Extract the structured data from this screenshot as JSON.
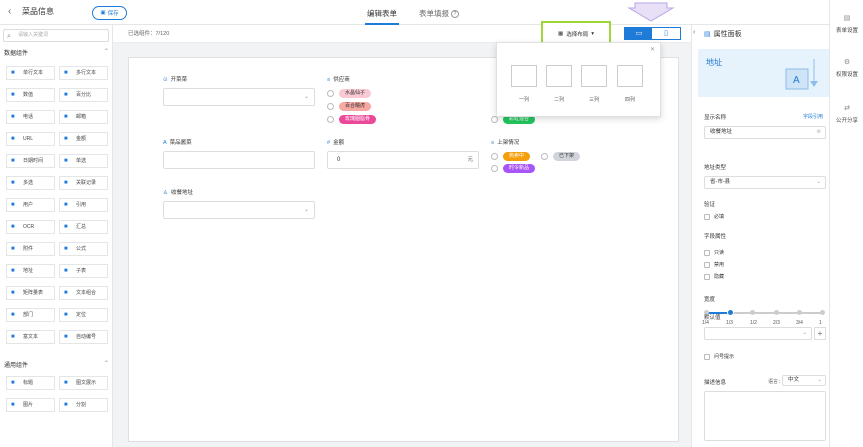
{
  "header": {
    "back_icon": "chevron-left-icon",
    "title": "菜品信息",
    "save_label": "保存",
    "tabs": [
      {
        "label": "编辑表单",
        "active": true
      },
      {
        "label": "表单填报",
        "active": false
      }
    ]
  },
  "left": {
    "search_placeholder": "请输入关键词",
    "groups": [
      {
        "title": "数据组件",
        "items": [
          {
            "label": "单行文本",
            "icon": "text-icon"
          },
          {
            "label": "多行文本",
            "icon": "multiline-icon"
          },
          {
            "label": "数值",
            "icon": "number-icon"
          },
          {
            "label": "百分比",
            "icon": "percent-icon"
          },
          {
            "label": "电话",
            "icon": "phone-icon"
          },
          {
            "label": "邮箱",
            "icon": "mail-icon"
          },
          {
            "label": "URL",
            "icon": "link-icon"
          },
          {
            "label": "金额",
            "icon": "money-icon"
          },
          {
            "label": "日期时间",
            "icon": "calendar-icon"
          },
          {
            "label": "单选",
            "icon": "radio-icon"
          },
          {
            "label": "多选",
            "icon": "checkbox-icon"
          },
          {
            "label": "关联记录",
            "icon": "relation-icon"
          },
          {
            "label": "用户",
            "icon": "user-icon"
          },
          {
            "label": "引用",
            "icon": "quote-icon"
          },
          {
            "label": "OCR",
            "icon": "ocr-icon"
          },
          {
            "label": "汇总",
            "icon": "sum-icon"
          },
          {
            "label": "附件",
            "icon": "attachment-icon"
          },
          {
            "label": "公式",
            "icon": "formula-icon"
          },
          {
            "label": "地址",
            "icon": "location-icon"
          },
          {
            "label": "子表",
            "icon": "subtable-icon"
          },
          {
            "label": "矩阵量表",
            "icon": "matrix-icon"
          },
          {
            "label": "文本组合",
            "icon": "text-combo-icon"
          },
          {
            "label": "部门",
            "icon": "department-icon"
          },
          {
            "label": "定位",
            "icon": "position-icon"
          },
          {
            "label": "富文本",
            "icon": "richtext-icon"
          },
          {
            "label": "自动编号",
            "icon": "autonumber-icon"
          }
        ]
      },
      {
        "title": "通用组件",
        "items": [
          {
            "label": "标题",
            "icon": "heading-icon"
          },
          {
            "label": "图文展示",
            "icon": "image-text-icon"
          },
          {
            "label": "图片",
            "icon": "image-icon"
          },
          {
            "label": "分割",
            "icon": "divider-icon"
          }
        ]
      }
    ]
  },
  "canvas": {
    "selected_count": "已选组件：7/120",
    "fields": [
      {
        "label": "开菜菜",
        "icon": "radio-circle-icon"
      },
      {
        "label": "供应商",
        "icon": "list-icon",
        "options": [
          "水晶仙子",
          "百合糯虎",
          "玫瑰胭脂骨"
        ],
        "colors": [
          "#f9c9d4",
          "#f7a8a3",
          "#ec4899"
        ]
      },
      {
        "label": "彩虹混合",
        "color": "#22c55e"
      },
      {
        "label": "菜品酱菜",
        "icon": "text-icon"
      },
      {
        "label": "金额",
        "icon": "hash-icon",
        "value": "0",
        "unit": "元"
      },
      {
        "label": "上架情况",
        "icon": "list-icon",
        "options": [
          "热卖中",
          "已下架",
          "时令新品"
        ],
        "colors": [
          "#f59e0b",
          "#d1d5db",
          "#a855f7"
        ]
      },
      {
        "label": "收餐地址",
        "icon": "user-icon"
      }
    ]
  },
  "toolbar": {
    "layout_label": "选择布局",
    "layout_icon": "layout-icon",
    "desktop_icon": "desktop-icon",
    "mobile_icon": "mobile-icon",
    "layouts": [
      "一列",
      "二列",
      "三列",
      "四列"
    ]
  },
  "props": {
    "title": "属性面板",
    "banner_title": "地址",
    "display_name_label": "显示名称",
    "link_label": "字段引用",
    "display_name_value": "收餐地址",
    "address_type_label": "地址类型",
    "address_type_value": "省-市-县",
    "validate_label": "验证",
    "required_label": "必填",
    "field_attr_label": "字段属性",
    "readonly_label": "只读",
    "disabled_label": "禁用",
    "hidden_label": "隐藏",
    "width_label": "宽度",
    "width_ticks": [
      "1/4",
      "1/3",
      "1/2",
      "2/3",
      "3/4",
      "1"
    ],
    "width_value": "1/3",
    "default_label": "默认值",
    "hint_label": "问号提示",
    "desc_label": "描述信息",
    "lang_label": "语言：",
    "lang_value": "中文"
  },
  "sidebar": [
    {
      "label": "表单设置",
      "icon": "form-settings-icon"
    },
    {
      "label": "权限设置",
      "icon": "permission-icon"
    },
    {
      "label": "公开分享",
      "icon": "share-icon"
    }
  ]
}
